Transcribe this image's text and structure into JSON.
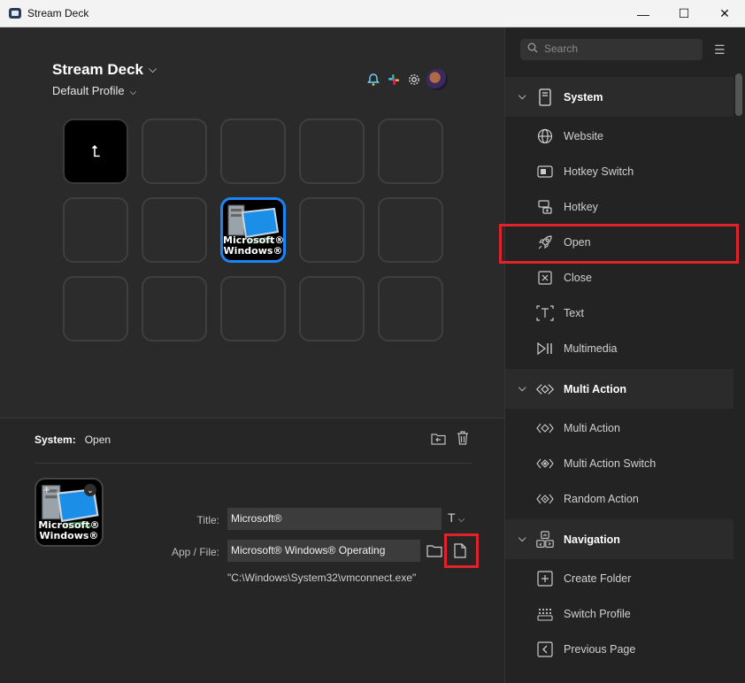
{
  "window": {
    "title": "Stream Deck",
    "minimize": "—",
    "maximize": "☐",
    "close": "✕"
  },
  "header": {
    "deck_name": "Stream Deck",
    "profile": "Default Profile"
  },
  "toolbar_icons": [
    "bell-icon",
    "slack-icon",
    "gear-icon",
    "avatar"
  ],
  "grid": {
    "back_glyph": "⮤",
    "selected_key_caption_1": "Microsoft®",
    "selected_key_caption_2": "Windows®"
  },
  "properties": {
    "category": "System:",
    "action": "Open",
    "preview_caption_1": "Microsoft®",
    "preview_caption_2": "Windows®",
    "title_label": "Title:",
    "title_value": "Microsoft®",
    "app_label": "App / File:",
    "app_value": "Microsoft® Windows® Operating",
    "path": "\"C:\\Windows\\System32\\vmconnect.exe\""
  },
  "sidebar": {
    "search_placeholder": "Search",
    "sections": [
      {
        "label": "System",
        "items": [
          "Website",
          "Hotkey Switch",
          "Hotkey",
          "Open",
          "Close",
          "Text",
          "Multimedia"
        ]
      },
      {
        "label": "Multi Action",
        "items": [
          "Multi Action",
          "Multi Action Switch",
          "Random Action"
        ]
      },
      {
        "label": "Navigation",
        "items": [
          "Create Folder",
          "Switch Profile",
          "Previous Page"
        ]
      }
    ]
  },
  "colors": {
    "highlight_red": "#e0222a",
    "selection_blue": "#1a86f5"
  }
}
